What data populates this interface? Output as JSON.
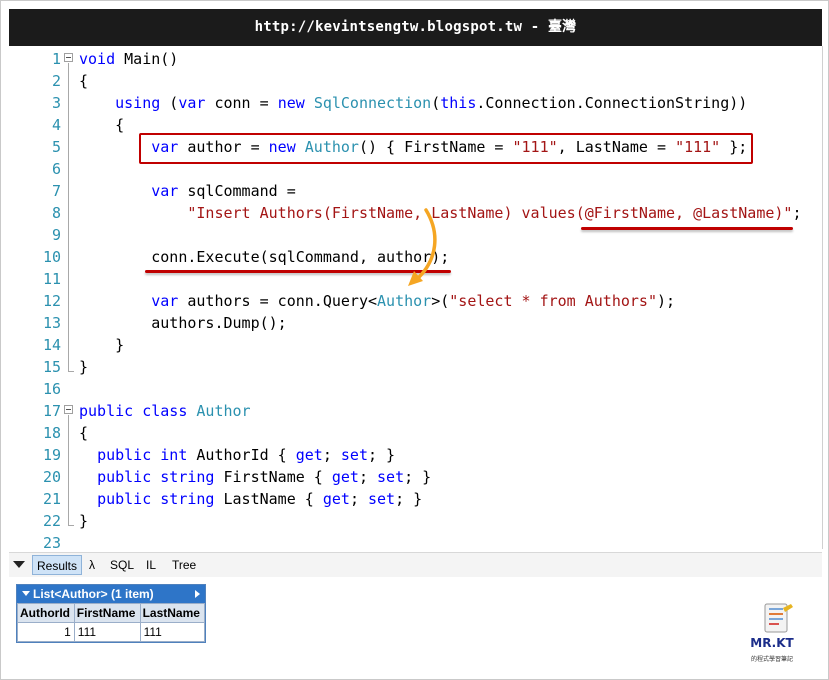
{
  "title": "http://kevintsengtw.blogspot.tw - 臺灣",
  "code_lines": [
    {
      "n": "1",
      "tokens": [
        {
          "t": "void",
          "c": "kw"
        },
        {
          "t": " Main()"
        }
      ]
    },
    {
      "n": "2",
      "tokens": [
        {
          "t": "{"
        }
      ]
    },
    {
      "n": "3",
      "tokens": [
        {
          "t": "    "
        },
        {
          "t": "using",
          "c": "kw"
        },
        {
          "t": " ("
        },
        {
          "t": "var",
          "c": "kw"
        },
        {
          "t": " conn = "
        },
        {
          "t": "new",
          "c": "kw"
        },
        {
          "t": " "
        },
        {
          "t": "SqlConnection",
          "c": "ty"
        },
        {
          "t": "("
        },
        {
          "t": "this",
          "c": "kw"
        },
        {
          "t": ".Connection.ConnectionString))"
        }
      ]
    },
    {
      "n": "4",
      "tokens": [
        {
          "t": "    {"
        }
      ]
    },
    {
      "n": "5",
      "tokens": [
        {
          "t": "        "
        },
        {
          "t": "var",
          "c": "kw"
        },
        {
          "t": " author = "
        },
        {
          "t": "new",
          "c": "kw"
        },
        {
          "t": " "
        },
        {
          "t": "Author",
          "c": "ty"
        },
        {
          "t": "() { FirstName = "
        },
        {
          "t": "\"111\"",
          "c": "str"
        },
        {
          "t": ", LastName = "
        },
        {
          "t": "\"111\"",
          "c": "str"
        },
        {
          "t": " };"
        }
      ]
    },
    {
      "n": "6",
      "tokens": []
    },
    {
      "n": "7",
      "tokens": [
        {
          "t": "        "
        },
        {
          "t": "var",
          "c": "kw"
        },
        {
          "t": " sqlCommand ="
        }
      ]
    },
    {
      "n": "8",
      "tokens": [
        {
          "t": "            "
        },
        {
          "t": "\"Insert Authors(FirstName, LastName) values(@FirstName, @LastName)\"",
          "c": "str"
        },
        {
          "t": ";"
        }
      ]
    },
    {
      "n": "9",
      "tokens": []
    },
    {
      "n": "10",
      "tokens": [
        {
          "t": "        conn.Execute(sqlCommand, author);"
        }
      ]
    },
    {
      "n": "11",
      "tokens": []
    },
    {
      "n": "12",
      "tokens": [
        {
          "t": "        "
        },
        {
          "t": "var",
          "c": "kw"
        },
        {
          "t": " authors = conn.Query<"
        },
        {
          "t": "Author",
          "c": "ty"
        },
        {
          "t": ">("
        },
        {
          "t": "\"select * from Authors\"",
          "c": "str"
        },
        {
          "t": ");"
        }
      ]
    },
    {
      "n": "13",
      "tokens": [
        {
          "t": "        authors.Dump();"
        }
      ]
    },
    {
      "n": "14",
      "tokens": [
        {
          "t": "    }"
        }
      ]
    },
    {
      "n": "15",
      "tokens": [
        {
          "t": "}"
        }
      ]
    },
    {
      "n": "16",
      "tokens": []
    },
    {
      "n": "17",
      "tokens": [
        {
          "t": "public",
          "c": "kw"
        },
        {
          "t": " "
        },
        {
          "t": "class",
          "c": "kw"
        },
        {
          "t": " "
        },
        {
          "t": "Author",
          "c": "ty"
        }
      ]
    },
    {
      "n": "18",
      "tokens": [
        {
          "t": "{"
        }
      ]
    },
    {
      "n": "19",
      "tokens": [
        {
          "t": "  "
        },
        {
          "t": "public",
          "c": "kw"
        },
        {
          "t": " "
        },
        {
          "t": "int",
          "c": "kw"
        },
        {
          "t": " AuthorId { "
        },
        {
          "t": "get",
          "c": "kw"
        },
        {
          "t": "; "
        },
        {
          "t": "set",
          "c": "kw"
        },
        {
          "t": "; }"
        }
      ]
    },
    {
      "n": "20",
      "tokens": [
        {
          "t": "  "
        },
        {
          "t": "public",
          "c": "kw"
        },
        {
          "t": " "
        },
        {
          "t": "string",
          "c": "kw"
        },
        {
          "t": " FirstName { "
        },
        {
          "t": "get",
          "c": "kw"
        },
        {
          "t": "; "
        },
        {
          "t": "set",
          "c": "kw"
        },
        {
          "t": "; }"
        }
      ]
    },
    {
      "n": "21",
      "tokens": [
        {
          "t": "  "
        },
        {
          "t": "public",
          "c": "kw"
        },
        {
          "t": " "
        },
        {
          "t": "string",
          "c": "kw"
        },
        {
          "t": " LastName { "
        },
        {
          "t": "get",
          "c": "kw"
        },
        {
          "t": "; "
        },
        {
          "t": "set",
          "c": "kw"
        },
        {
          "t": "; }"
        }
      ]
    },
    {
      "n": "22",
      "tokens": [
        {
          "t": "}"
        }
      ]
    },
    {
      "n": "23",
      "tokens": []
    }
  ],
  "tabs": {
    "results": "Results",
    "lambda": "λ",
    "sql": "SQL",
    "il": "IL",
    "tree": "Tree"
  },
  "result": {
    "header": "List<Author> (1 item)",
    "columns": [
      "AuthorId",
      "FirstName",
      "LastName"
    ],
    "rows": [
      [
        "1",
        "111",
        "111"
      ]
    ]
  },
  "logo": {
    "text": "MR.KT",
    "subtitle": "的程式學習筆記"
  },
  "colors": {
    "keyword": "#0000ff",
    "type": "#2b91af",
    "string": "#a31515",
    "annotation": "#c00000",
    "arrow": "#f5a623",
    "line_number": "#2b91af"
  }
}
